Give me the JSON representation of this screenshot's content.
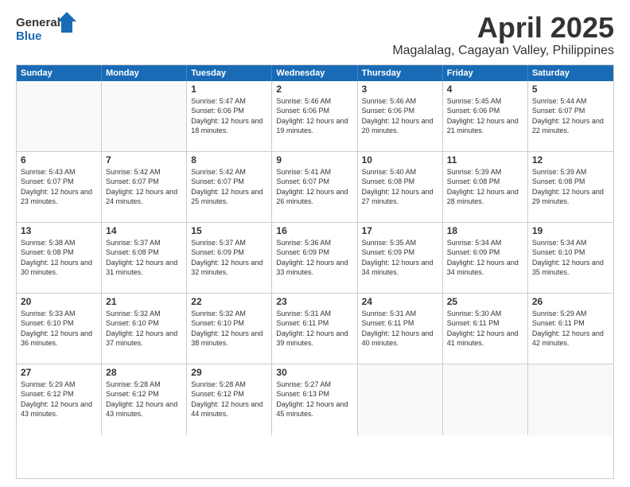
{
  "header": {
    "logo": {
      "general": "General",
      "blue": "Blue"
    },
    "month": "April 2025",
    "location": "Magalalag, Cagayan Valley, Philippines"
  },
  "weekdays": [
    "Sunday",
    "Monday",
    "Tuesday",
    "Wednesday",
    "Thursday",
    "Friday",
    "Saturday"
  ],
  "weeks": [
    [
      {
        "day": "",
        "sunrise": "",
        "sunset": "",
        "daylight": "",
        "empty": true
      },
      {
        "day": "",
        "sunrise": "",
        "sunset": "",
        "daylight": "",
        "empty": true
      },
      {
        "day": "1",
        "sunrise": "Sunrise: 5:47 AM",
        "sunset": "Sunset: 6:06 PM",
        "daylight": "Daylight: 12 hours and 18 minutes.",
        "empty": false
      },
      {
        "day": "2",
        "sunrise": "Sunrise: 5:46 AM",
        "sunset": "Sunset: 6:06 PM",
        "daylight": "Daylight: 12 hours and 19 minutes.",
        "empty": false
      },
      {
        "day": "3",
        "sunrise": "Sunrise: 5:46 AM",
        "sunset": "Sunset: 6:06 PM",
        "daylight": "Daylight: 12 hours and 20 minutes.",
        "empty": false
      },
      {
        "day": "4",
        "sunrise": "Sunrise: 5:45 AM",
        "sunset": "Sunset: 6:06 PM",
        "daylight": "Daylight: 12 hours and 21 minutes.",
        "empty": false
      },
      {
        "day": "5",
        "sunrise": "Sunrise: 5:44 AM",
        "sunset": "Sunset: 6:07 PM",
        "daylight": "Daylight: 12 hours and 22 minutes.",
        "empty": false
      }
    ],
    [
      {
        "day": "6",
        "sunrise": "Sunrise: 5:43 AM",
        "sunset": "Sunset: 6:07 PM",
        "daylight": "Daylight: 12 hours and 23 minutes.",
        "empty": false
      },
      {
        "day": "7",
        "sunrise": "Sunrise: 5:42 AM",
        "sunset": "Sunset: 6:07 PM",
        "daylight": "Daylight: 12 hours and 24 minutes.",
        "empty": false
      },
      {
        "day": "8",
        "sunrise": "Sunrise: 5:42 AM",
        "sunset": "Sunset: 6:07 PM",
        "daylight": "Daylight: 12 hours and 25 minutes.",
        "empty": false
      },
      {
        "day": "9",
        "sunrise": "Sunrise: 5:41 AM",
        "sunset": "Sunset: 6:07 PM",
        "daylight": "Daylight: 12 hours and 26 minutes.",
        "empty": false
      },
      {
        "day": "10",
        "sunrise": "Sunrise: 5:40 AM",
        "sunset": "Sunset: 6:08 PM",
        "daylight": "Daylight: 12 hours and 27 minutes.",
        "empty": false
      },
      {
        "day": "11",
        "sunrise": "Sunrise: 5:39 AM",
        "sunset": "Sunset: 6:08 PM",
        "daylight": "Daylight: 12 hours and 28 minutes.",
        "empty": false
      },
      {
        "day": "12",
        "sunrise": "Sunrise: 5:39 AM",
        "sunset": "Sunset: 6:08 PM",
        "daylight": "Daylight: 12 hours and 29 minutes.",
        "empty": false
      }
    ],
    [
      {
        "day": "13",
        "sunrise": "Sunrise: 5:38 AM",
        "sunset": "Sunset: 6:08 PM",
        "daylight": "Daylight: 12 hours and 30 minutes.",
        "empty": false
      },
      {
        "day": "14",
        "sunrise": "Sunrise: 5:37 AM",
        "sunset": "Sunset: 6:08 PM",
        "daylight": "Daylight: 12 hours and 31 minutes.",
        "empty": false
      },
      {
        "day": "15",
        "sunrise": "Sunrise: 5:37 AM",
        "sunset": "Sunset: 6:09 PM",
        "daylight": "Daylight: 12 hours and 32 minutes.",
        "empty": false
      },
      {
        "day": "16",
        "sunrise": "Sunrise: 5:36 AM",
        "sunset": "Sunset: 6:09 PM",
        "daylight": "Daylight: 12 hours and 33 minutes.",
        "empty": false
      },
      {
        "day": "17",
        "sunrise": "Sunrise: 5:35 AM",
        "sunset": "Sunset: 6:09 PM",
        "daylight": "Daylight: 12 hours and 34 minutes.",
        "empty": false
      },
      {
        "day": "18",
        "sunrise": "Sunrise: 5:34 AM",
        "sunset": "Sunset: 6:09 PM",
        "daylight": "Daylight: 12 hours and 34 minutes.",
        "empty": false
      },
      {
        "day": "19",
        "sunrise": "Sunrise: 5:34 AM",
        "sunset": "Sunset: 6:10 PM",
        "daylight": "Daylight: 12 hours and 35 minutes.",
        "empty": false
      }
    ],
    [
      {
        "day": "20",
        "sunrise": "Sunrise: 5:33 AM",
        "sunset": "Sunset: 6:10 PM",
        "daylight": "Daylight: 12 hours and 36 minutes.",
        "empty": false
      },
      {
        "day": "21",
        "sunrise": "Sunrise: 5:32 AM",
        "sunset": "Sunset: 6:10 PM",
        "daylight": "Daylight: 12 hours and 37 minutes.",
        "empty": false
      },
      {
        "day": "22",
        "sunrise": "Sunrise: 5:32 AM",
        "sunset": "Sunset: 6:10 PM",
        "daylight": "Daylight: 12 hours and 38 minutes.",
        "empty": false
      },
      {
        "day": "23",
        "sunrise": "Sunrise: 5:31 AM",
        "sunset": "Sunset: 6:11 PM",
        "daylight": "Daylight: 12 hours and 39 minutes.",
        "empty": false
      },
      {
        "day": "24",
        "sunrise": "Sunrise: 5:31 AM",
        "sunset": "Sunset: 6:11 PM",
        "daylight": "Daylight: 12 hours and 40 minutes.",
        "empty": false
      },
      {
        "day": "25",
        "sunrise": "Sunrise: 5:30 AM",
        "sunset": "Sunset: 6:11 PM",
        "daylight": "Daylight: 12 hours and 41 minutes.",
        "empty": false
      },
      {
        "day": "26",
        "sunrise": "Sunrise: 5:29 AM",
        "sunset": "Sunset: 6:11 PM",
        "daylight": "Daylight: 12 hours and 42 minutes.",
        "empty": false
      }
    ],
    [
      {
        "day": "27",
        "sunrise": "Sunrise: 5:29 AM",
        "sunset": "Sunset: 6:12 PM",
        "daylight": "Daylight: 12 hours and 43 minutes.",
        "empty": false
      },
      {
        "day": "28",
        "sunrise": "Sunrise: 5:28 AM",
        "sunset": "Sunset: 6:12 PM",
        "daylight": "Daylight: 12 hours and 43 minutes.",
        "empty": false
      },
      {
        "day": "29",
        "sunrise": "Sunrise: 5:28 AM",
        "sunset": "Sunset: 6:12 PM",
        "daylight": "Daylight: 12 hours and 44 minutes.",
        "empty": false
      },
      {
        "day": "30",
        "sunrise": "Sunrise: 5:27 AM",
        "sunset": "Sunset: 6:13 PM",
        "daylight": "Daylight: 12 hours and 45 minutes.",
        "empty": false
      },
      {
        "day": "",
        "sunrise": "",
        "sunset": "",
        "daylight": "",
        "empty": true
      },
      {
        "day": "",
        "sunrise": "",
        "sunset": "",
        "daylight": "",
        "empty": true
      },
      {
        "day": "",
        "sunrise": "",
        "sunset": "",
        "daylight": "",
        "empty": true
      }
    ]
  ]
}
